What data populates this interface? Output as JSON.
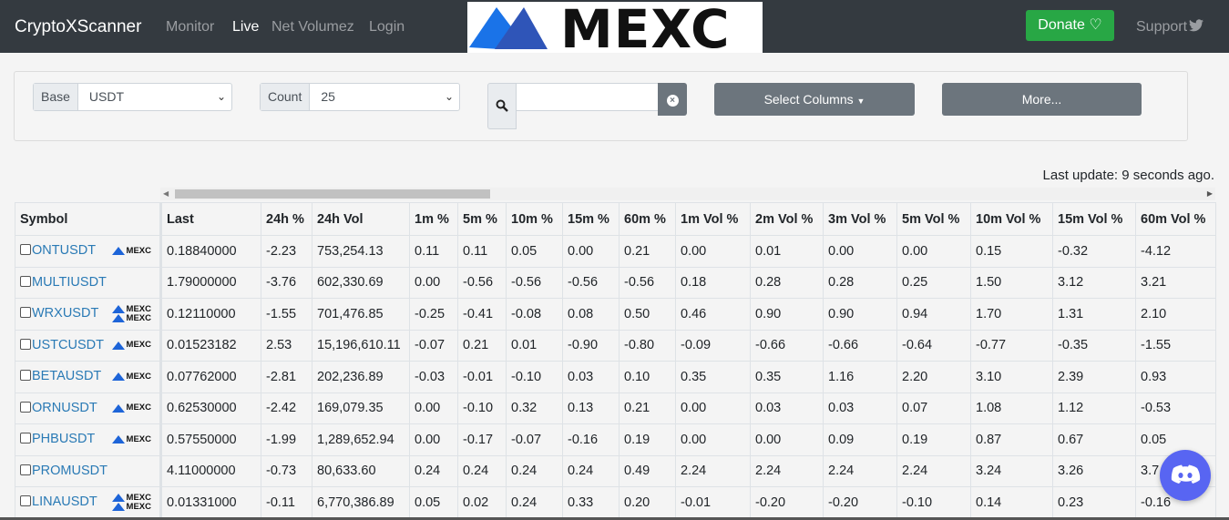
{
  "nav": {
    "brand": "CryptoXScanner",
    "links": [
      "Monitor",
      "Live",
      "Net Volumez",
      "Login"
    ],
    "active": "Live",
    "banner": "MEXC",
    "donate": "Donate",
    "support": "Support"
  },
  "filters": {
    "base_label": "Base",
    "base_value": "USDT",
    "count_label": "Count",
    "count_value": "25",
    "search_value": "",
    "select_columns": "Select Columns",
    "more": "More..."
  },
  "status": {
    "last_update": "Last update: 9 seconds ago."
  },
  "table": {
    "columns": [
      "Symbol",
      "Last",
      "24h %",
      "24h Vol",
      "1m %",
      "5m %",
      "10m %",
      "15m %",
      "60m %",
      "1m Vol %",
      "2m Vol %",
      "3m Vol %",
      "5m Vol %",
      "10m Vol %",
      "15m Vol %",
      "60m Vol %"
    ],
    "rows": [
      {
        "symbol": "ONTUSDT",
        "badges": 1,
        "values": [
          "0.18840000",
          "-2.23",
          "753,254.13",
          "0.11",
          "0.11",
          "0.05",
          "0.00",
          "0.21",
          "0.00",
          "0.01",
          "0.00",
          "0.00",
          "0.15",
          "-0.32",
          "-4.12"
        ]
      },
      {
        "symbol": "MULTIUSDT",
        "badges": 0,
        "values": [
          "1.79000000",
          "-3.76",
          "602,330.69",
          "0.00",
          "-0.56",
          "-0.56",
          "-0.56",
          "-0.56",
          "0.18",
          "0.28",
          "0.28",
          "0.25",
          "1.50",
          "3.12",
          "3.21"
        ]
      },
      {
        "symbol": "WRXUSDT",
        "badges": 2,
        "values": [
          "0.12110000",
          "-1.55",
          "701,476.85",
          "-0.25",
          "-0.41",
          "-0.08",
          "0.08",
          "0.50",
          "0.46",
          "0.90",
          "0.90",
          "0.94",
          "1.70",
          "1.31",
          "2.10"
        ]
      },
      {
        "symbol": "USTCUSDT",
        "badges": 1,
        "values": [
          "0.01523182",
          "2.53",
          "15,196,610.11",
          "-0.07",
          "0.21",
          "0.01",
          "-0.90",
          "-0.80",
          "-0.09",
          "-0.66",
          "-0.66",
          "-0.64",
          "-0.77",
          "-0.35",
          "-1.55"
        ]
      },
      {
        "symbol": "BETAUSDT",
        "badges": 1,
        "values": [
          "0.07762000",
          "-2.81",
          "202,236.89",
          "-0.03",
          "-0.01",
          "-0.10",
          "0.03",
          "0.10",
          "0.35",
          "0.35",
          "1.16",
          "2.20",
          "3.10",
          "2.39",
          "0.93"
        ]
      },
      {
        "symbol": "ORNUSDT",
        "badges": 1,
        "values": [
          "0.62530000",
          "-2.42",
          "169,079.35",
          "0.00",
          "-0.10",
          "0.32",
          "0.13",
          "0.21",
          "0.00",
          "0.03",
          "0.03",
          "0.07",
          "1.08",
          "1.12",
          "-0.53"
        ]
      },
      {
        "symbol": "PHBUSDT",
        "badges": 1,
        "values": [
          "0.57550000",
          "-1.99",
          "1,289,652.94",
          "0.00",
          "-0.17",
          "-0.07",
          "-0.16",
          "0.19",
          "0.00",
          "0.00",
          "0.09",
          "0.19",
          "0.87",
          "0.67",
          "0.05"
        ]
      },
      {
        "symbol": "PROMUSDT",
        "badges": 0,
        "values": [
          "4.11000000",
          "-0.73",
          "80,633.60",
          "0.24",
          "0.24",
          "0.24",
          "0.24",
          "0.49",
          "2.24",
          "2.24",
          "2.24",
          "2.24",
          "3.24",
          "3.26",
          "3.7"
        ]
      },
      {
        "symbol": "LINAUSDT",
        "badges": 2,
        "values": [
          "0.01331000",
          "-0.11",
          "6,770,386.89",
          "0.05",
          "0.02",
          "0.24",
          "0.33",
          "0.20",
          "-0.01",
          "-0.20",
          "-0.20",
          "-0.10",
          "0.14",
          "0.23",
          "-0.16"
        ]
      }
    ],
    "badge_label": "MEXC"
  },
  "colors": {
    "navbar": "#343a40",
    "donate": "#28a745",
    "link": "#2a7ab5",
    "discord": "#5865f2",
    "mexc_blue": "#1d64d8"
  }
}
